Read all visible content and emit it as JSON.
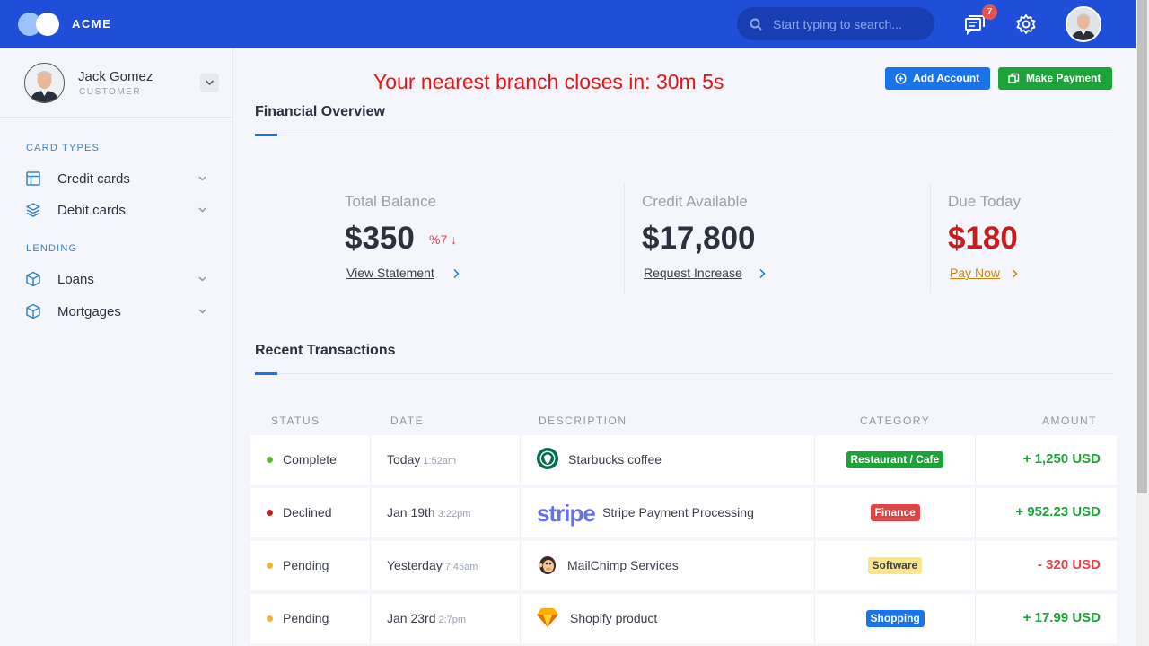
{
  "app": {
    "brand": "ACME",
    "notification_count": "7"
  },
  "search": {
    "placeholder": "Start typing to search..."
  },
  "user": {
    "name": "Jack Gomez",
    "role": "CUSTOMER"
  },
  "sidebar": {
    "sections": [
      {
        "label": "CARD TYPES",
        "items": [
          {
            "label": "Credit cards",
            "icon": "credit-card-icon"
          },
          {
            "label": "Debit cards",
            "icon": "layers-icon"
          }
        ]
      },
      {
        "label": "LENDING",
        "items": [
          {
            "label": "Loans",
            "icon": "box-icon"
          },
          {
            "label": "Mortgages",
            "icon": "box-icon"
          }
        ]
      }
    ]
  },
  "main": {
    "countdown": "Your nearest branch closes in: 30m 5s",
    "actions": {
      "add_account": "Add Account",
      "make_payment": "Make Payment"
    },
    "overview": {
      "title": "Financial Overview",
      "stats": [
        {
          "label": "Total Balance",
          "value": "$350",
          "change": "%7 ↓",
          "link": "View Statement",
          "link_color": "#1a73e8",
          "value_color": "#2c3140"
        },
        {
          "label": "Credit Available",
          "value": "$17,800",
          "link": "Request Increase",
          "link_color": "#1a73e8",
          "value_color": "#2c3140"
        },
        {
          "label": "Due Today",
          "value": "$180",
          "link": "Pay Now",
          "link_color": "#c9851a",
          "value_color": "#c41e1e"
        }
      ]
    },
    "transactions": {
      "title": "Recent Transactions",
      "columns": [
        "STATUS",
        "DATE",
        "DESCRIPTION",
        "CATEGORY",
        "AMOUNT"
      ],
      "rows": [
        {
          "status": "Complete",
          "status_color": "#5cb82e",
          "date": "Today",
          "time": "1:52am",
          "logo": "starbucks-logo",
          "description": "Starbucks coffee",
          "category": "Restaurant / Cafe",
          "category_bg": "#1ea33a",
          "category_fg": "#ffffff",
          "amount": "+ 1,250 USD",
          "amount_color": "#1ea33a"
        },
        {
          "status": "Declined",
          "status_color": "#c41e1e",
          "date": "Jan 19th",
          "time": "3:22pm",
          "logo": "stripe-logo",
          "logo_text": "stripe",
          "description": "Stripe Payment Processing",
          "category": "Finance",
          "category_bg": "#e04545",
          "category_fg": "#ffffff",
          "amount": "+ 952.23 USD",
          "amount_color": "#1ea33a"
        },
        {
          "status": "Pending",
          "status_color": "#f0b429",
          "date": "Yesterday",
          "time": "7:45am",
          "logo": "mailchimp-logo",
          "description": "MailChimp Services",
          "category": "Software",
          "category_bg": "#fbe58a",
          "category_fg": "#3a3f4b",
          "amount": "- 320 USD",
          "amount_color": "#e04545"
        },
        {
          "status": "Pending",
          "status_color": "#f0b429",
          "date": "Jan 23rd",
          "time": "2:7pm",
          "logo": "sketch-logo",
          "description": "Shopify product",
          "category": "Shopping",
          "category_bg": "#1a73e8",
          "category_fg": "#ffffff",
          "amount": "+ 17.99 USD",
          "amount_color": "#1ea33a"
        }
      ]
    }
  },
  "colors": {
    "topbar": "#1f4ed8",
    "accent": "#1a73e8",
    "success": "#1ea33a",
    "danger": "#e04545"
  }
}
